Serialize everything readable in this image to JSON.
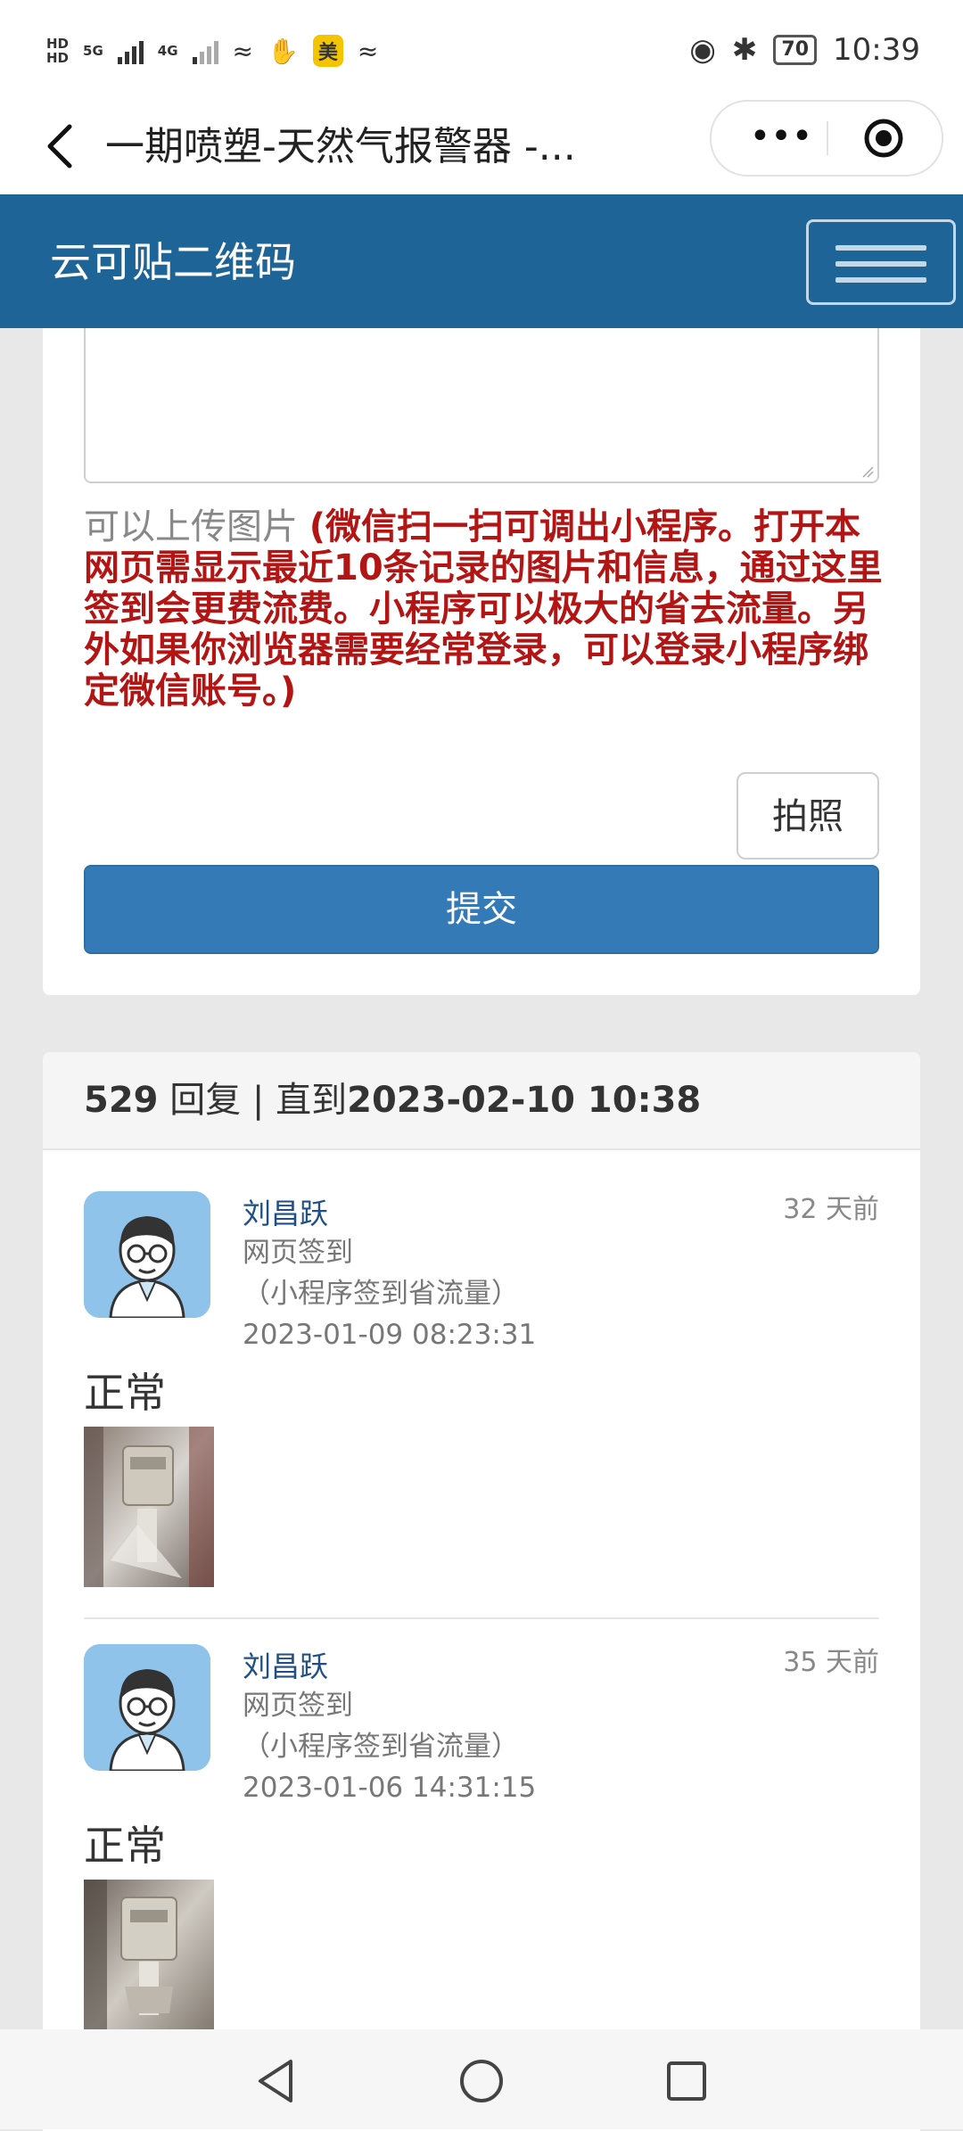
{
  "status_bar": {
    "hd1": "HD",
    "hd2": "HD",
    "net1": "5G",
    "net2": "4G",
    "mei": "美",
    "battery": "70",
    "time": "10:39"
  },
  "title_bar": {
    "title": "一期喷塑-天然气报警器 -...",
    "more_label": "•••"
  },
  "navbar": {
    "brand": "云可贴二维码"
  },
  "form": {
    "hint_gray": "可以上传图片",
    "hint_red": "(微信扫一扫可调出小程序。打开本网页需显示最近10条记录的图片和信息，通过这里签到会更费流费。小程序可以极大的省去流量。另外如果你浏览器需要经常登录，可以登录小程序绑定微信账号。)",
    "photo_button": "拍照",
    "submit_button": "提交"
  },
  "replies_header": {
    "count": "529",
    "label": "回复 | 直到",
    "until": "2023-02-10 10:38"
  },
  "replies": [
    {
      "name": "刘昌跃",
      "method": "网页签到",
      "tip": "（小程序签到省流量）",
      "datetime": "2023-01-09 08:23:31",
      "ago": "32 天前",
      "status": "正常"
    },
    {
      "name": "刘昌跃",
      "method": "网页签到",
      "tip": "（小程序签到省流量）",
      "datetime": "2023-01-06 14:31:15",
      "ago": "35 天前",
      "status": "正常"
    }
  ],
  "colors": {
    "navbar": "#1e6496",
    "submit": "#337ab7",
    "hint_red": "#b31414",
    "name_link": "#1e4f86"
  },
  "icons": [
    "back-icon",
    "more-icon",
    "target-icon",
    "menu-icon",
    "avatar-icon",
    "nav-back-icon",
    "nav-home-icon",
    "nav-recents-icon"
  ]
}
